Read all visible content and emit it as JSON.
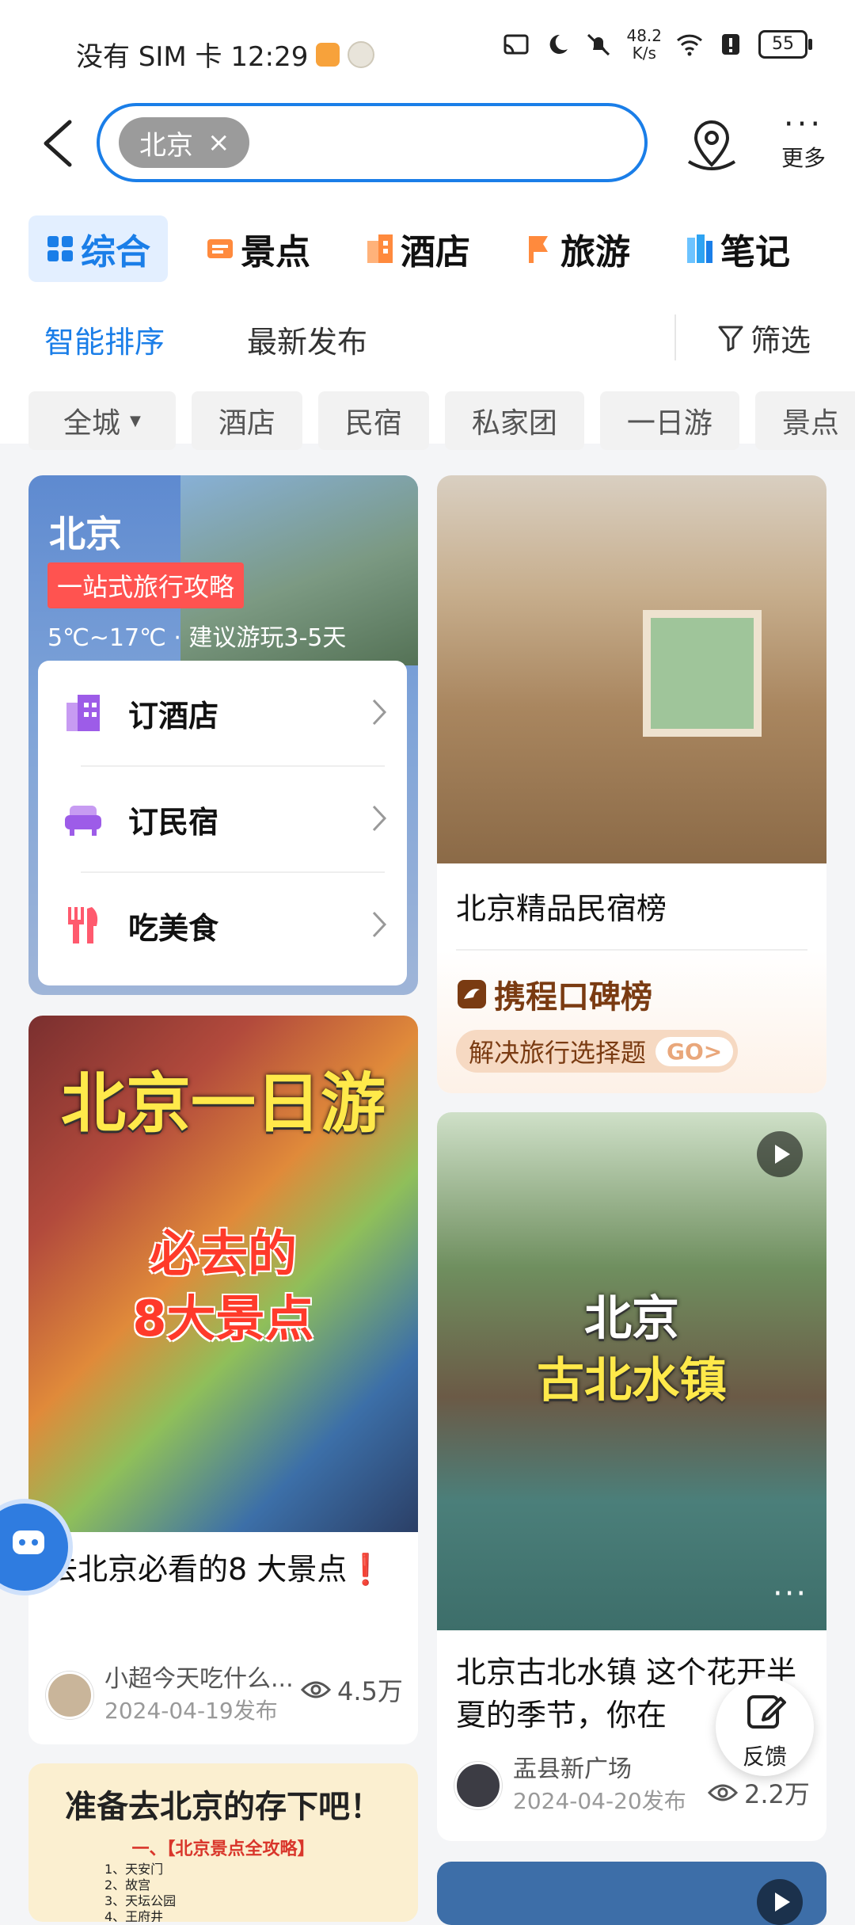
{
  "status_bar": {
    "carrier_time": "没有 SIM 卡 12:29",
    "net_speed_value": "48.2",
    "net_speed_unit": "K/s",
    "battery": "55"
  },
  "search": {
    "chip_label": "北京",
    "chip_close": "×",
    "more_label": "更多"
  },
  "tabs": [
    {
      "label": "综合",
      "icon": "grid-icon",
      "color": "#1a7ee8"
    },
    {
      "label": "景点",
      "icon": "ticket-icon",
      "color": "#ff8a3d"
    },
    {
      "label": "酒店",
      "icon": "hotel-icon",
      "color": "#ff8a3d"
    },
    {
      "label": "旅游",
      "icon": "flag-icon",
      "color": "#ff8a3d"
    },
    {
      "label": "笔记",
      "icon": "note-icon",
      "color": "#2ea3f2"
    }
  ],
  "sort": {
    "smart": "智能排序",
    "latest": "最新发布",
    "filter": "筛选"
  },
  "filter_chips": [
    "全城",
    "酒店",
    "民宿",
    "私家团",
    "一日游",
    "景点"
  ],
  "guide_card": {
    "city": "北京",
    "tag": "一站式旅行攻略",
    "weather": "5℃~17℃ · 建议游玩3-5天",
    "items": [
      {
        "label": "订酒店",
        "icon": "hotel-icon"
      },
      {
        "label": "订民宿",
        "icon": "sofa-icon"
      },
      {
        "label": "吃美食",
        "icon": "cutlery-icon"
      }
    ]
  },
  "minsu_card": {
    "title": "北京精品民宿榜",
    "brand": "携程口碑榜",
    "slogan": "解决旅行选择题",
    "go": "GO>"
  },
  "post1": {
    "img_line1": "北京一日游",
    "img_line2": "必去的",
    "img_line3": "8大景点",
    "title": "去北京必看的8 大景点❗",
    "author": "小超今天吃什么...",
    "date": "2024-04-19发布",
    "views": "4.5万"
  },
  "post2": {
    "img_line1": "北京",
    "img_line2": "古北水镇",
    "title": "北京古北水镇 这个花开半夏的季节，你在",
    "author": "盂县新广场",
    "date": "2024-04-20发布",
    "views": "2.2万"
  },
  "post3": {
    "title": "准备去北京的存下吧！",
    "subtitle": "一、【北京景点全攻略】",
    "list": [
      "1、天安门",
      "2、故宫",
      "3、天坛公园",
      "4、王府井"
    ]
  },
  "feedback": {
    "label": "反馈"
  }
}
